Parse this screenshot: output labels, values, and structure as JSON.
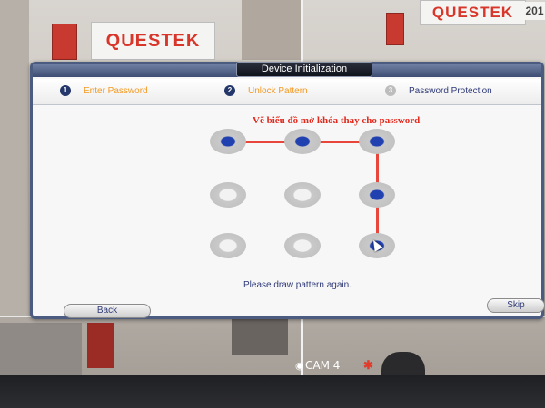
{
  "dialog": {
    "title": "Device Initialization",
    "steps": [
      {
        "number": "1",
        "label": "Enter Password",
        "state": "done"
      },
      {
        "number": "2",
        "label": "Unlock Pattern",
        "state": "current"
      },
      {
        "number": "3",
        "label": "Password Protection",
        "state": "pending"
      }
    ],
    "instruction": "Vẽ biểu đồ mở khóa thay cho password",
    "pattern": {
      "grid": 3,
      "selected_dots": [
        1,
        2,
        3,
        6,
        9
      ]
    },
    "status_message": "Please draw pattern again.",
    "back_label": "Back",
    "skip_label": "Skip"
  },
  "background": {
    "brand_left": "QUESTEK",
    "brand_right": "QUESTEK",
    "year_fragment": "201",
    "camera_label": "CAM 4"
  },
  "colors": {
    "dialog_border": "#4b5c80",
    "step_active": "#24376a",
    "step_orange": "#f39a22",
    "pattern_line": "#e8463b",
    "selected_dot": "#2141b0",
    "instruction_red": "#e3281c"
  }
}
